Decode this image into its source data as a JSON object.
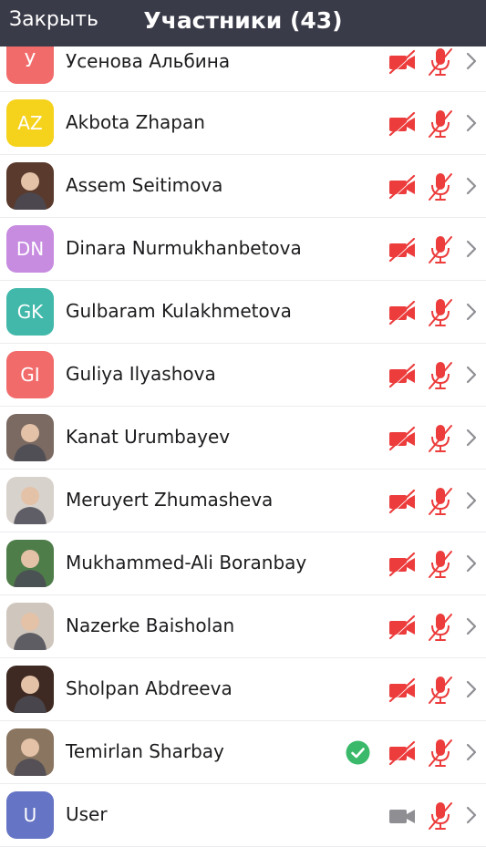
{
  "header": {
    "close_label": "Закрыть",
    "title": "Участники (43)",
    "background": "#3a3b49"
  },
  "colors": {
    "muted_red": "#ec3c3c",
    "camera_on_gray": "#8e8e93",
    "chevron_gray": "#8e8e93",
    "check_green": "#3ab96a"
  },
  "participants": [
    {
      "name": "Усенова Альбина",
      "initials": "У",
      "avatar_color": "#f26b6b",
      "avatar_type": "initials",
      "video": "off",
      "audio": "muted"
    },
    {
      "name": "Akbota Zhapan",
      "initials": "AZ",
      "avatar_color": "#f5d21c",
      "avatar_type": "initials",
      "video": "off",
      "audio": "muted"
    },
    {
      "name": "Assem Seitimova",
      "initials": "",
      "avatar_color": "#5a3a2c",
      "avatar_type": "photo",
      "video": "off",
      "audio": "muted"
    },
    {
      "name": "Dinara Nurmukhanbetova",
      "initials": "DN",
      "avatar_color": "#c78be0",
      "avatar_type": "initials",
      "video": "off",
      "audio": "muted"
    },
    {
      "name": "Gulbaram Kulakhmetova",
      "initials": "GK",
      "avatar_color": "#41b8aa",
      "avatar_type": "initials",
      "video": "off",
      "audio": "muted"
    },
    {
      "name": "Guliya Ilyashova",
      "initials": "GI",
      "avatar_color": "#f26b6b",
      "avatar_type": "initials",
      "video": "off",
      "audio": "muted"
    },
    {
      "name": "Kanat Urumbayev",
      "initials": "",
      "avatar_color": "#7a6a62",
      "avatar_type": "photo",
      "video": "off",
      "audio": "muted"
    },
    {
      "name": "Meruyert Zhumasheva",
      "initials": "",
      "avatar_color": "#d8d2cc",
      "avatar_type": "photo",
      "video": "off",
      "audio": "muted"
    },
    {
      "name": "Mukhammed-Ali Boranbay",
      "initials": "",
      "avatar_color": "#4f7d4a",
      "avatar_type": "photo",
      "video": "off",
      "audio": "muted"
    },
    {
      "name": "Nazerke Baisholan",
      "initials": "",
      "avatar_color": "#cfc6bd",
      "avatar_type": "photo",
      "video": "off",
      "audio": "muted"
    },
    {
      "name": "Sholpan Abdreeva",
      "initials": "",
      "avatar_color": "#3e2a22",
      "avatar_type": "photo",
      "video": "off",
      "audio": "muted"
    },
    {
      "name": "Temirlan Sharbay",
      "initials": "",
      "avatar_color": "#8a7660",
      "avatar_type": "photo",
      "video": "off",
      "audio": "muted",
      "verified": true
    },
    {
      "name": "User",
      "initials": "U",
      "avatar_color": "#6574c4",
      "avatar_type": "initials",
      "video": "on",
      "audio": "muted"
    }
  ]
}
